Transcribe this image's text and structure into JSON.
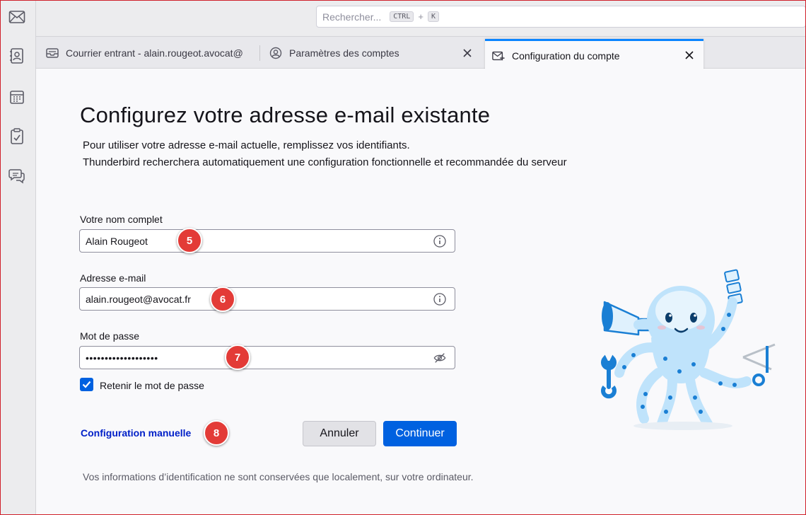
{
  "search": {
    "placeholder": "Rechercher...",
    "shortcut_key1": "CTRL",
    "shortcut_plus": "+",
    "shortcut_key2": "K"
  },
  "spaces": [
    {
      "name": "mail",
      "icon": "mail-icon"
    },
    {
      "name": "address-book",
      "icon": "address-book-icon"
    },
    {
      "name": "calendar",
      "icon": "calendar-icon"
    },
    {
      "name": "tasks",
      "icon": "tasks-icon"
    },
    {
      "name": "chat",
      "icon": "chat-icon"
    }
  ],
  "tabs": [
    {
      "label": "Courrier entrant - alain.rougeot.avocat@",
      "icon": "inbox-icon",
      "active": false
    },
    {
      "label": "Paramètres des comptes",
      "icon": "account-settings-icon",
      "active": false
    },
    {
      "label": "Configuration du compte",
      "icon": "account-setup-icon",
      "active": true
    }
  ],
  "main": {
    "title": "Configurez votre adresse e-mail existante",
    "desc_line1": "Pour utiliser votre adresse e-mail actuelle, remplissez vos identifiants.",
    "desc_line2": "Thunderbird recherchera automatiquement une configuration fonctionnelle et recommandée du serveur",
    "name_label": "Votre nom complet",
    "name_value": "Alain Rougeot",
    "email_label": "Adresse e-mail",
    "email_value": "alain.rougeot@avocat.fr",
    "password_label": "Mot de passe",
    "password_value": "•••••••••••••••••••",
    "remember_label": "Retenir le mot de passe",
    "remember_checked": true,
    "manual_config": "Configuration manuelle",
    "cancel": "Annuler",
    "continue": "Continuer",
    "note": "Vos informations d’identification ne sont conservées que localement, sur votre ordinateur."
  },
  "markers": [
    "5",
    "6",
    "7",
    "8"
  ],
  "colors": {
    "accent": "#0061e0",
    "tab_highlight": "#0a84ff",
    "link": "#0020c8",
    "marker": "#e33b37"
  }
}
